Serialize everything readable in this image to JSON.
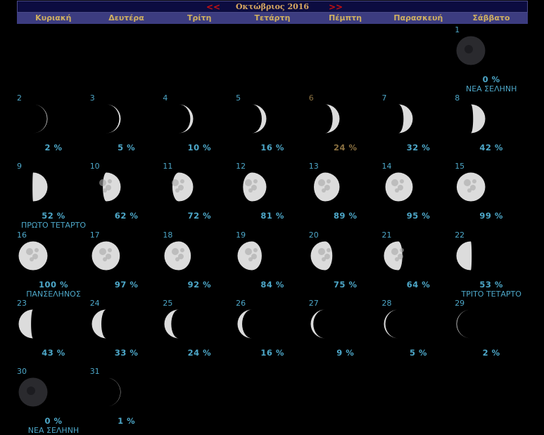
{
  "header": {
    "prev_label": "<<",
    "next_label": ">>",
    "title": "Οκτώβριος 2016"
  },
  "weekdays": [
    "Κυριακή",
    "Δευτέρα",
    "Τρίτη",
    "Τετάρτη",
    "Πέμπτη",
    "Παρασκευή",
    "Σάββατο"
  ],
  "colors": {
    "text": "#4da7c8",
    "today": "#8a7040",
    "header_bg": "#0c0c40",
    "weekday_bg": "#3c3c80",
    "title": "#d8a860",
    "nav": "#c81010"
  },
  "days": [
    {
      "day": "1",
      "pct": "0 %",
      "phase": "ΝΕΑ ΣΕΛΗΝΗ",
      "illum": 0.0,
      "waxing": true
    },
    {
      "day": "2",
      "pct": "2 %",
      "illum": 0.02,
      "waxing": true
    },
    {
      "day": "3",
      "pct": "5 %",
      "illum": 0.05,
      "waxing": true
    },
    {
      "day": "4",
      "pct": "10 %",
      "illum": 0.1,
      "waxing": true
    },
    {
      "day": "5",
      "pct": "16 %",
      "illum": 0.16,
      "waxing": true
    },
    {
      "day": "6",
      "pct": "24 %",
      "illum": 0.24,
      "waxing": true,
      "today": true
    },
    {
      "day": "7",
      "pct": "32 %",
      "illum": 0.32,
      "waxing": true
    },
    {
      "day": "8",
      "pct": "42 %",
      "illum": 0.42,
      "waxing": true
    },
    {
      "day": "9",
      "pct": "52 %",
      "phase": "ΠΡΩΤΟ ΤΕΤΑΡΤΟ",
      "illum": 0.52,
      "waxing": true
    },
    {
      "day": "10",
      "pct": "62 %",
      "illum": 0.62,
      "waxing": true
    },
    {
      "day": "11",
      "pct": "72 %",
      "illum": 0.72,
      "waxing": true
    },
    {
      "day": "12",
      "pct": "81 %",
      "illum": 0.81,
      "waxing": true
    },
    {
      "day": "13",
      "pct": "89 %",
      "illum": 0.89,
      "waxing": true
    },
    {
      "day": "14",
      "pct": "95 %",
      "illum": 0.95,
      "waxing": true
    },
    {
      "day": "15",
      "pct": "99 %",
      "illum": 0.99,
      "waxing": true
    },
    {
      "day": "16",
      "pct": "100 %",
      "phase": "ΠΑΝΣΕΛΗΝΟΣ",
      "illum": 1.0,
      "waxing": true
    },
    {
      "day": "17",
      "pct": "97 %",
      "illum": 0.97,
      "waxing": false
    },
    {
      "day": "18",
      "pct": "92 %",
      "illum": 0.92,
      "waxing": false
    },
    {
      "day": "19",
      "pct": "84 %",
      "illum": 0.84,
      "waxing": false
    },
    {
      "day": "20",
      "pct": "75 %",
      "illum": 0.75,
      "waxing": false
    },
    {
      "day": "21",
      "pct": "64 %",
      "illum": 0.64,
      "waxing": false
    },
    {
      "day": "22",
      "pct": "53 %",
      "phase": "ΤΡΙΤΟ ΤΕΤΑΡΤΟ",
      "illum": 0.53,
      "waxing": false
    },
    {
      "day": "23",
      "pct": "43 %",
      "illum": 0.43,
      "waxing": false
    },
    {
      "day": "24",
      "pct": "33 %",
      "illum": 0.33,
      "waxing": false
    },
    {
      "day": "25",
      "pct": "24 %",
      "illum": 0.24,
      "waxing": false
    },
    {
      "day": "26",
      "pct": "16 %",
      "illum": 0.16,
      "waxing": false
    },
    {
      "day": "27",
      "pct": "9 %",
      "illum": 0.09,
      "waxing": false
    },
    {
      "day": "28",
      "pct": "5 %",
      "illum": 0.05,
      "waxing": false
    },
    {
      "day": "29",
      "pct": "2 %",
      "illum": 0.02,
      "waxing": false
    },
    {
      "day": "30",
      "pct": "0 %",
      "phase": "ΝΕΑ ΣΕΛΗΝΗ",
      "illum": 0.0,
      "waxing": false
    },
    {
      "day": "31",
      "pct": "1 %",
      "illum": 0.01,
      "waxing": true
    }
  ]
}
